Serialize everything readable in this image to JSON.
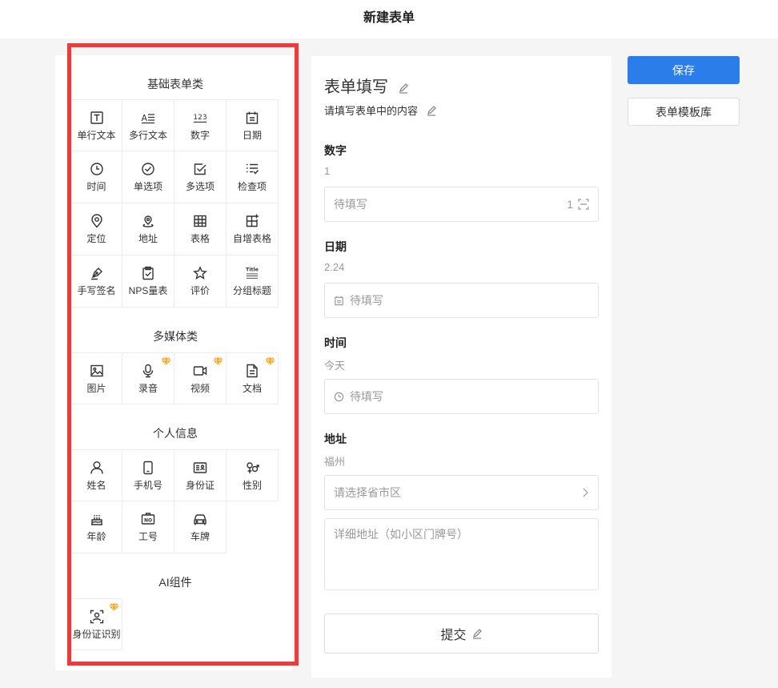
{
  "header": {
    "title": "新建表单"
  },
  "palette": {
    "sections": [
      {
        "title": "基础表单类",
        "items": [
          {
            "label": "单行文本",
            "icon": "text-t-icon"
          },
          {
            "label": "多行文本",
            "icon": "multiline-text-icon",
            "glyph": "A≡"
          },
          {
            "label": "数字",
            "icon": "number-icon",
            "glyph": "123"
          },
          {
            "label": "日期",
            "icon": "calendar-icon"
          },
          {
            "label": "时间",
            "icon": "clock-icon"
          },
          {
            "label": "单选项",
            "icon": "radio-check-icon"
          },
          {
            "label": "多选项",
            "icon": "checkbox-icon"
          },
          {
            "label": "检查项",
            "icon": "checklist-icon"
          },
          {
            "label": "定位",
            "icon": "location-pin-icon"
          },
          {
            "label": "地址",
            "icon": "address-pin-icon"
          },
          {
            "label": "表格",
            "icon": "table-icon"
          },
          {
            "label": "自增表格",
            "icon": "table-plus-icon"
          },
          {
            "label": "手写签名",
            "icon": "pen-nib-icon"
          },
          {
            "label": "NPS量表",
            "icon": "nps-clipboard-icon"
          },
          {
            "label": "评价",
            "icon": "star-icon"
          },
          {
            "label": "分组标题",
            "icon": "title-icon",
            "glyph": "Title"
          }
        ]
      },
      {
        "title": "多媒体类",
        "items": [
          {
            "label": "图片",
            "icon": "image-icon"
          },
          {
            "label": "录音",
            "icon": "microphone-icon",
            "premium": true
          },
          {
            "label": "视频",
            "icon": "video-camera-icon",
            "premium": true
          },
          {
            "label": "文档",
            "icon": "document-icon",
            "premium": true
          }
        ]
      },
      {
        "title": "个人信息",
        "items": [
          {
            "label": "姓名",
            "icon": "person-icon"
          },
          {
            "label": "手机号",
            "icon": "mobile-phone-icon"
          },
          {
            "label": "身份证",
            "icon": "id-card-icon"
          },
          {
            "label": "性别",
            "icon": "gender-icon"
          },
          {
            "label": "年龄",
            "icon": "birthday-cake-icon"
          },
          {
            "label": "工号",
            "icon": "employee-number-icon",
            "glyph": "NO"
          },
          {
            "label": "车牌",
            "icon": "car-icon"
          }
        ]
      },
      {
        "title": "AI组件",
        "items": [
          {
            "label": "身份证识别",
            "icon": "id-scan-icon",
            "premium": true
          }
        ]
      }
    ]
  },
  "form": {
    "title": "表单填写",
    "subtitle": "请填写表单中的内容",
    "fields": {
      "number": {
        "label": "数字",
        "hint": "1",
        "placeholder": "待填写",
        "counter": "1"
      },
      "date": {
        "label": "日期",
        "hint": "2.24",
        "placeholder": "待填写"
      },
      "time": {
        "label": "时间",
        "hint": "今天",
        "placeholder": "待填写"
      },
      "address": {
        "label": "地址",
        "hint": "福州",
        "region_placeholder": "请选择省市区",
        "detail_placeholder": "详细地址（如小区门牌号）"
      }
    },
    "submit_label": "提交"
  },
  "actions": {
    "save_label": "保存",
    "template_label": "表单模板库"
  },
  "colors": {
    "accent": "#2b7de9",
    "highlight_frame": "#f03a3a",
    "premium_gem": "#f5a623"
  }
}
